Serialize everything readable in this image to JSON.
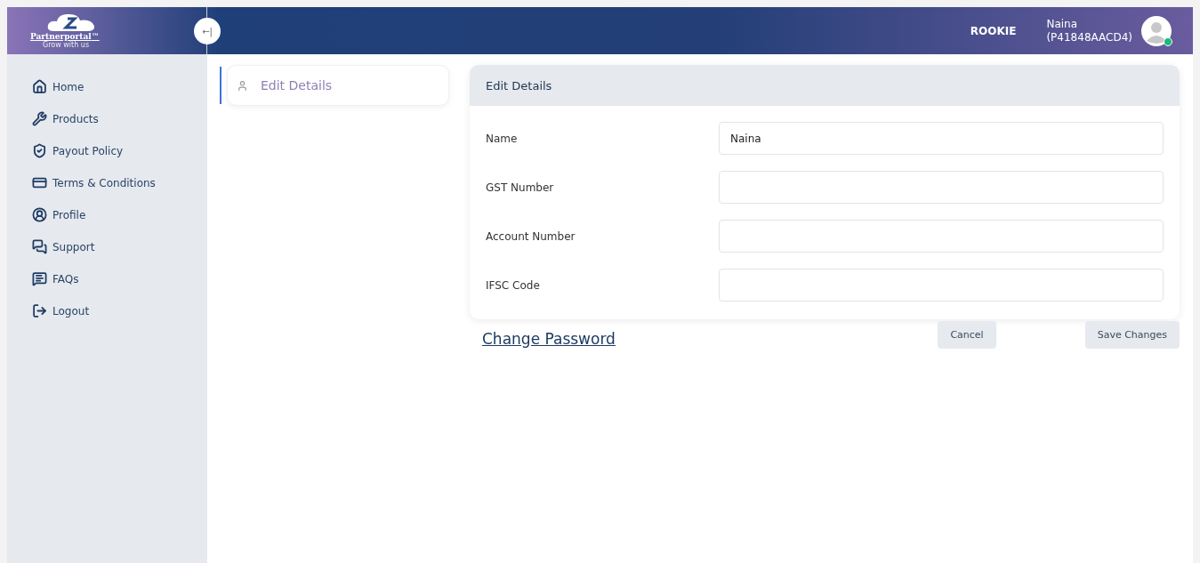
{
  "header": {
    "logo": {
      "name": "Partnerportal",
      "trademark": "™",
      "tagline": "Grow with us"
    },
    "collapse_button": "←|",
    "level": "ROOKIE",
    "user": {
      "name": "Naina",
      "id": "(P41848AACD4)",
      "online": true
    }
  },
  "sidebar": {
    "items": [
      {
        "label": "Home"
      },
      {
        "label": "Products"
      },
      {
        "label": "Payout Policy"
      },
      {
        "label": "Terms & Conditions"
      },
      {
        "label": "Profile"
      },
      {
        "label": "Support"
      },
      {
        "label": "FAQs"
      },
      {
        "label": "Logout"
      }
    ]
  },
  "tabs": [
    {
      "label": "Edit Details",
      "selected": true
    }
  ],
  "form": {
    "title": "Edit Details",
    "fields": [
      {
        "label": "Name",
        "value": "Naina"
      },
      {
        "label": "GST Number"
      },
      {
        "label": "Account Number"
      },
      {
        "label": "IFSC Code"
      }
    ]
  },
  "change_password": "Change Password",
  "buttons": [
    "Cancel",
    "Save Changes"
  ]
}
